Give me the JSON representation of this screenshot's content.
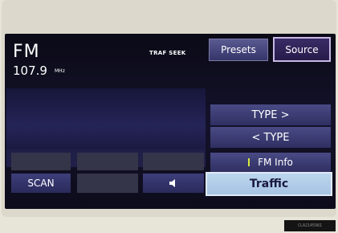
{
  "radio": {
    "band": "FM",
    "frequency": "107.9",
    "unit": "MHz",
    "traf_seek": "TRAF SEEK"
  },
  "buttons": {
    "presets": "Presets",
    "source": "Source",
    "type_up": "TYPE >",
    "type_down": "< TYPE",
    "fm_info": "FM Info",
    "traffic": "Traffic",
    "scan": "SCAN"
  },
  "disabled_buttons": [
    "",
    "",
    "",
    ""
  ],
  "icons": {
    "speaker": "speaker-icon",
    "indicator": "indicator-led"
  },
  "colors": {
    "traffic_highlight": "#a6c3e2",
    "fm_info_indicator": "#d8ea3a"
  },
  "image_code": "CLA2145981"
}
